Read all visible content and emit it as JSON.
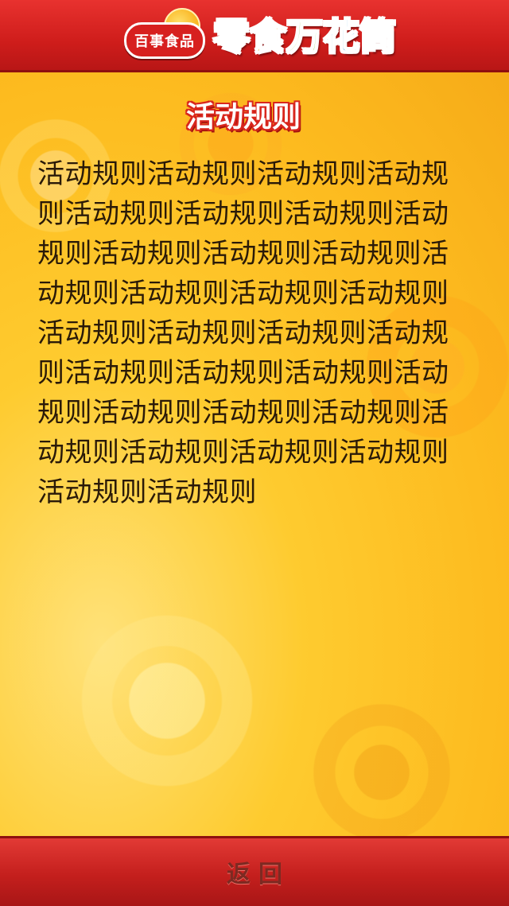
{
  "header": {
    "logo_text": "百事食品",
    "title_chars": [
      {
        "char": "零",
        "color": "#e8317a"
      },
      {
        "char": "食",
        "color": "#f2a41a"
      },
      {
        "char": "万",
        "color": "#7bbf2a"
      },
      {
        "char": "花",
        "color": "#3fa6d8"
      },
      {
        "char": "筒",
        "color": "#8a4fc6"
      }
    ]
  },
  "rules": {
    "title": "活动规则",
    "body": "活动规则活动规则活动规则活动规则活动规则活动规则活动规则活动规则活动规则活动规则活动规则活动规则活动规则活动规则活动规则活动规则活动规则活动规则活动规则活动规则活动规则活动规则活动规则活动规则活动规则活动规则活动规则活动规则活动规则活动规则活动规则活动规则"
  },
  "footer": {
    "back_label": "返回"
  },
  "colors": {
    "header_red": "#d7201f",
    "panel_yellow": "#fdbb1f",
    "title_red": "#d9261d",
    "body_text": "#2a1a08",
    "back_text": "#7d2a22"
  }
}
